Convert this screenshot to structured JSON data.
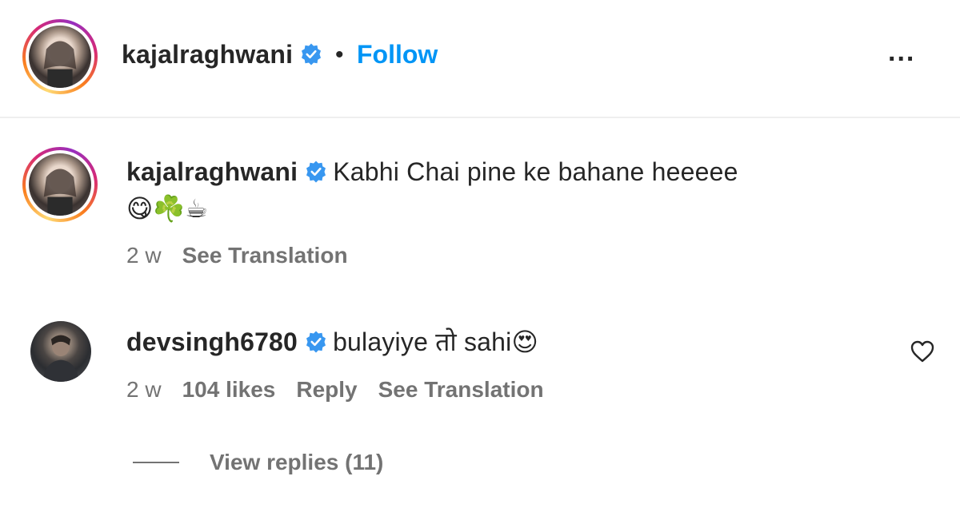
{
  "header": {
    "username": "kajalraghwani",
    "separator": "•",
    "follow_label": "Follow",
    "more_label": "..."
  },
  "caption": {
    "username": "kajalraghwani",
    "text": "Kabhi Chai pine ke bahane heeeee",
    "emoji": "😋☘️☕",
    "time": "2 w",
    "see_translation": "See Translation"
  },
  "comment": {
    "username": "devsingh6780",
    "text": "bulayiye तो sahi😍",
    "time": "2 w",
    "likes": "104 likes",
    "reply": "Reply",
    "see_translation": "See Translation",
    "view_replies": "View replies (11)"
  },
  "colors": {
    "accent": "#0095f6",
    "verified": "#3897f0",
    "muted": "#737373",
    "text": "#262626"
  },
  "icons": [
    "verified-badge-icon",
    "more-options-icon",
    "heart-icon"
  ]
}
